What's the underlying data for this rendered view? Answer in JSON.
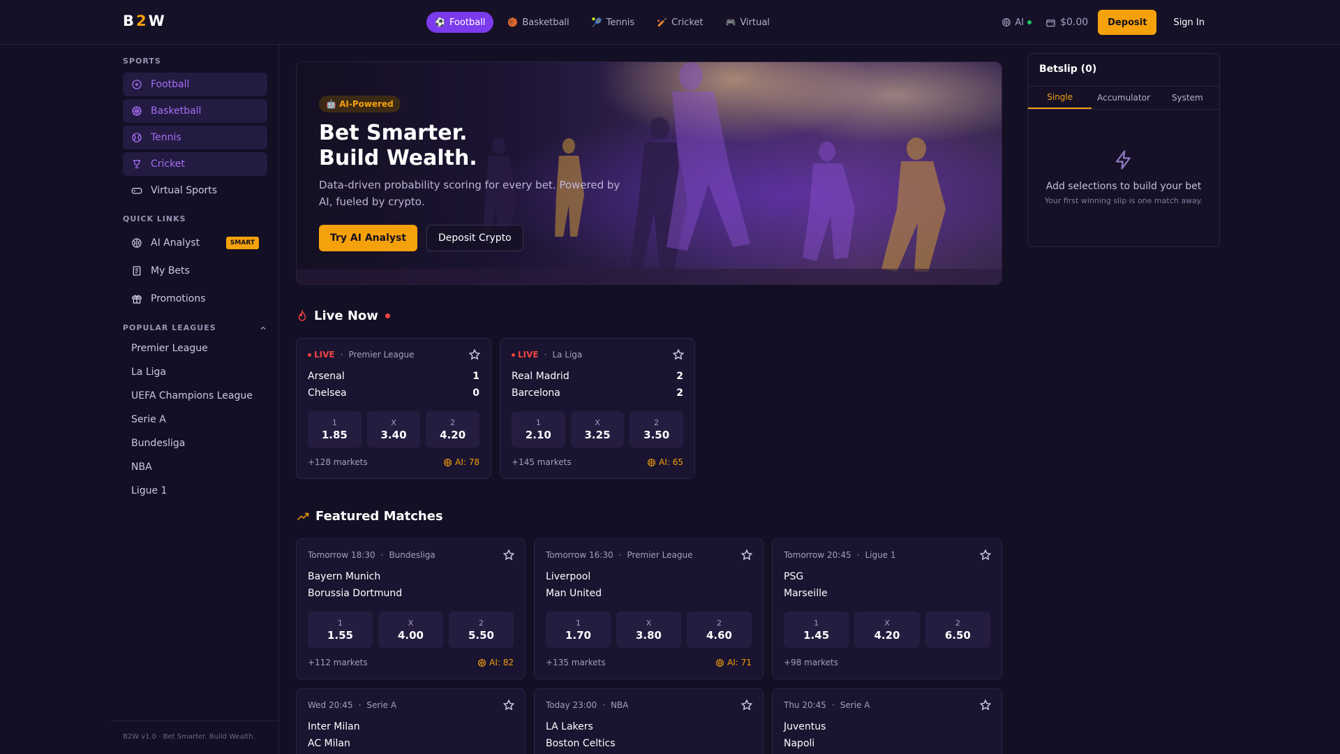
{
  "header": {
    "logo": {
      "left": "B",
      "mid": "2",
      "right": "W"
    },
    "nav": [
      {
        "label": "Football",
        "icon": "⚽"
      },
      {
        "label": "Basketball",
        "icon": "🏀"
      },
      {
        "label": "Tennis",
        "icon": "🎾"
      },
      {
        "label": "Cricket",
        "icon": "🏏"
      },
      {
        "label": "Virtual",
        "icon": "🎮"
      }
    ],
    "ai_label": "AI",
    "balance": "$0.00",
    "deposit_label": "Deposit",
    "signin_label": "Sign In"
  },
  "sidebar": {
    "sports_heading": "SPORTS",
    "sports": [
      {
        "label": "Football"
      },
      {
        "label": "Basketball"
      },
      {
        "label": "Tennis"
      },
      {
        "label": "Cricket"
      },
      {
        "label": "Virtual Sports"
      }
    ],
    "quick_links_heading": "QUICK LINKS",
    "quick_links": [
      {
        "label": "AI Analyst",
        "badge": "SMART"
      },
      {
        "label": "My Bets"
      },
      {
        "label": "Promotions"
      }
    ],
    "leagues_heading": "POPULAR LEAGUES",
    "leagues": [
      "Premier League",
      "La Liga",
      "UEFA Champions League",
      "Serie A",
      "Bundesliga",
      "NBA",
      "Ligue 1"
    ],
    "footer": "B2W v1.0 · Bet Smarter. Build Wealth."
  },
  "hero": {
    "badge": "🤖 AI-Powered",
    "title_line1": "Bet Smarter.",
    "title_line2": "Build Wealth.",
    "subtitle": "Data-driven probability scoring for every bet. Powered by AI, fueled by crypto.",
    "primary_cta": "Try AI Analyst",
    "secondary_cta": "Deposit Crypto"
  },
  "live": {
    "title": "Live Now",
    "live_label": "LIVE",
    "matches": [
      {
        "league": "Premier League",
        "home": "Arsenal",
        "away": "Chelsea",
        "home_score": "1",
        "away_score": "0",
        "odds": [
          {
            "label": "1",
            "value": "1.85"
          },
          {
            "label": "X",
            "value": "3.40"
          },
          {
            "label": "2",
            "value": "4.20"
          }
        ],
        "markets": "+128 markets",
        "ai": "AI: 78"
      },
      {
        "league": "La Liga",
        "home": "Real Madrid",
        "away": "Barcelona",
        "home_score": "2",
        "away_score": "2",
        "odds": [
          {
            "label": "1",
            "value": "2.10"
          },
          {
            "label": "X",
            "value": "3.25"
          },
          {
            "label": "2",
            "value": "3.50"
          }
        ],
        "markets": "+145 markets",
        "ai": "AI: 65"
      }
    ]
  },
  "featured": {
    "title": "Featured Matches",
    "matches": [
      {
        "time": "Tomorrow 18:30",
        "league": "Bundesliga",
        "home": "Bayern Munich",
        "away": "Borussia Dortmund",
        "odds": [
          {
            "label": "1",
            "value": "1.55"
          },
          {
            "label": "X",
            "value": "4.00"
          },
          {
            "label": "2",
            "value": "5.50"
          }
        ],
        "markets": "+112 markets",
        "ai": "AI: 82"
      },
      {
        "time": "Tomorrow 16:30",
        "league": "Premier League",
        "home": "Liverpool",
        "away": "Man United",
        "odds": [
          {
            "label": "1",
            "value": "1.70"
          },
          {
            "label": "X",
            "value": "3.80"
          },
          {
            "label": "2",
            "value": "4.60"
          }
        ],
        "markets": "+135 markets",
        "ai": "AI: 71"
      },
      {
        "time": "Tomorrow 20:45",
        "league": "Ligue 1",
        "home": "PSG",
        "away": "Marseille",
        "odds": [
          {
            "label": "1",
            "value": "1.45"
          },
          {
            "label": "X",
            "value": "4.20"
          },
          {
            "label": "2",
            "value": "6.50"
          }
        ],
        "markets": "+98 markets",
        "ai": ""
      },
      {
        "time": "Wed 20:45",
        "league": "Serie A",
        "home": "Inter Milan",
        "away": "AC Milan"
      },
      {
        "time": "Today 23:00",
        "league": "NBA",
        "home": "LA Lakers",
        "away": "Boston Celtics"
      },
      {
        "time": "Thu 20:45",
        "league": "Serie A",
        "home": "Juventus",
        "away": "Napoli"
      }
    ]
  },
  "betslip": {
    "title": "Betslip (0)",
    "tabs": [
      "Single",
      "Accumulator",
      "System"
    ],
    "empty_title": "Add selections to build your bet",
    "empty_sub": "Your first winning slip is one match away."
  },
  "colors": {
    "accent": "#7c3aed",
    "gold": "#f5a10b",
    "live": "#ef4444",
    "bg": "#130f24"
  }
}
